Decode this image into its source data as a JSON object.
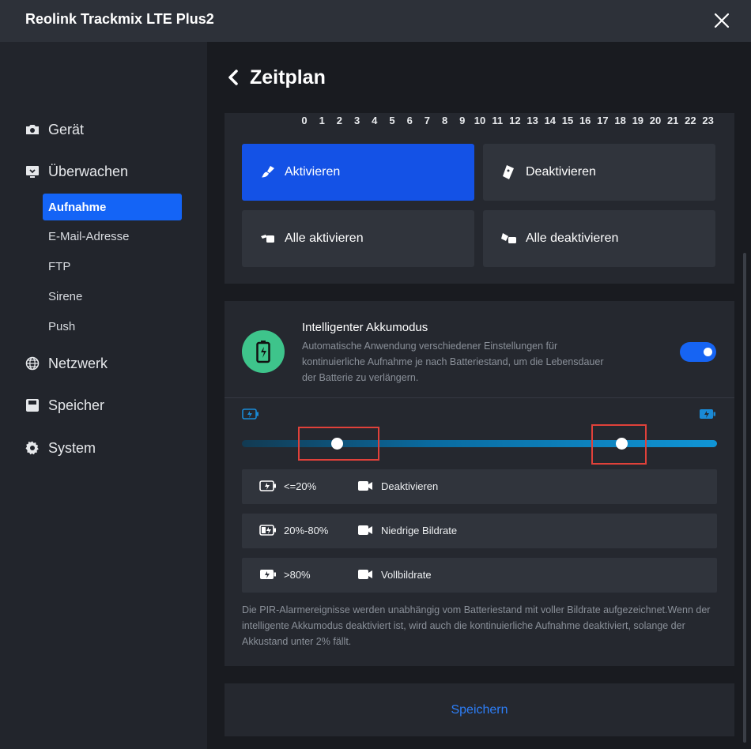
{
  "window": {
    "title": "Reolink Trackmix LTE Plus2"
  },
  "sidebar": {
    "items": [
      {
        "label": "Gerät",
        "icon": "camera-icon"
      },
      {
        "label": "Überwachen",
        "icon": "monitor-icon"
      },
      {
        "label": "Netzwerk",
        "icon": "globe-icon"
      },
      {
        "label": "Speicher",
        "icon": "storage-icon"
      },
      {
        "label": "System",
        "icon": "gear-icon"
      }
    ],
    "subitems": [
      "Aufnahme",
      "E-Mail-Adresse",
      "FTP",
      "Sirene",
      "Push"
    ],
    "active_subitem": "Aufnahme"
  },
  "main": {
    "title": "Zeitplan",
    "hours": [
      "0",
      "1",
      "2",
      "3",
      "4",
      "5",
      "6",
      "7",
      "8",
      "9",
      "10",
      "11",
      "12",
      "13",
      "14",
      "15",
      "16",
      "17",
      "18",
      "19",
      "20",
      "21",
      "22",
      "23"
    ],
    "buttons": {
      "activate": "Aktivieren",
      "deactivate": "Deaktivieren",
      "activate_all": "Alle aktivieren",
      "deactivate_all": "Alle deaktivieren"
    }
  },
  "akku": {
    "title": "Intelligenter Akkumodus",
    "description": "Automatische Anwendung verschiedener Einstellungen für kontinuierliche Aufnahme je nach Batteriestand, um die Lebensdauer der Batterie zu verlängern.",
    "enabled": true,
    "slider": {
      "low_threshold_percent": 20,
      "high_threshold_percent": 80
    },
    "rows": [
      {
        "level": "<=20%",
        "mode": "Deaktivieren"
      },
      {
        "level": "20%-80%",
        "mode": "Niedrige Bildrate"
      },
      {
        "level": ">80%",
        "mode": "Vollbildrate"
      }
    ],
    "note": "Die PIR-Alarmereignisse werden unabhängig vom Batteriestand mit voller Bildrate aufgezeichnet.Wenn der intelligente Akkumodus deaktiviert ist, wird auch die kontinuierliche Aufnahme deaktiviert, solange der Akkustand unter 2% fällt."
  },
  "footer": {
    "save_label": "Speichern"
  },
  "colors": {
    "accent": "#1464f6",
    "battery_green": "#3ec48b",
    "highlight_red": "#e0413a",
    "link_blue": "#2d7ef7"
  }
}
